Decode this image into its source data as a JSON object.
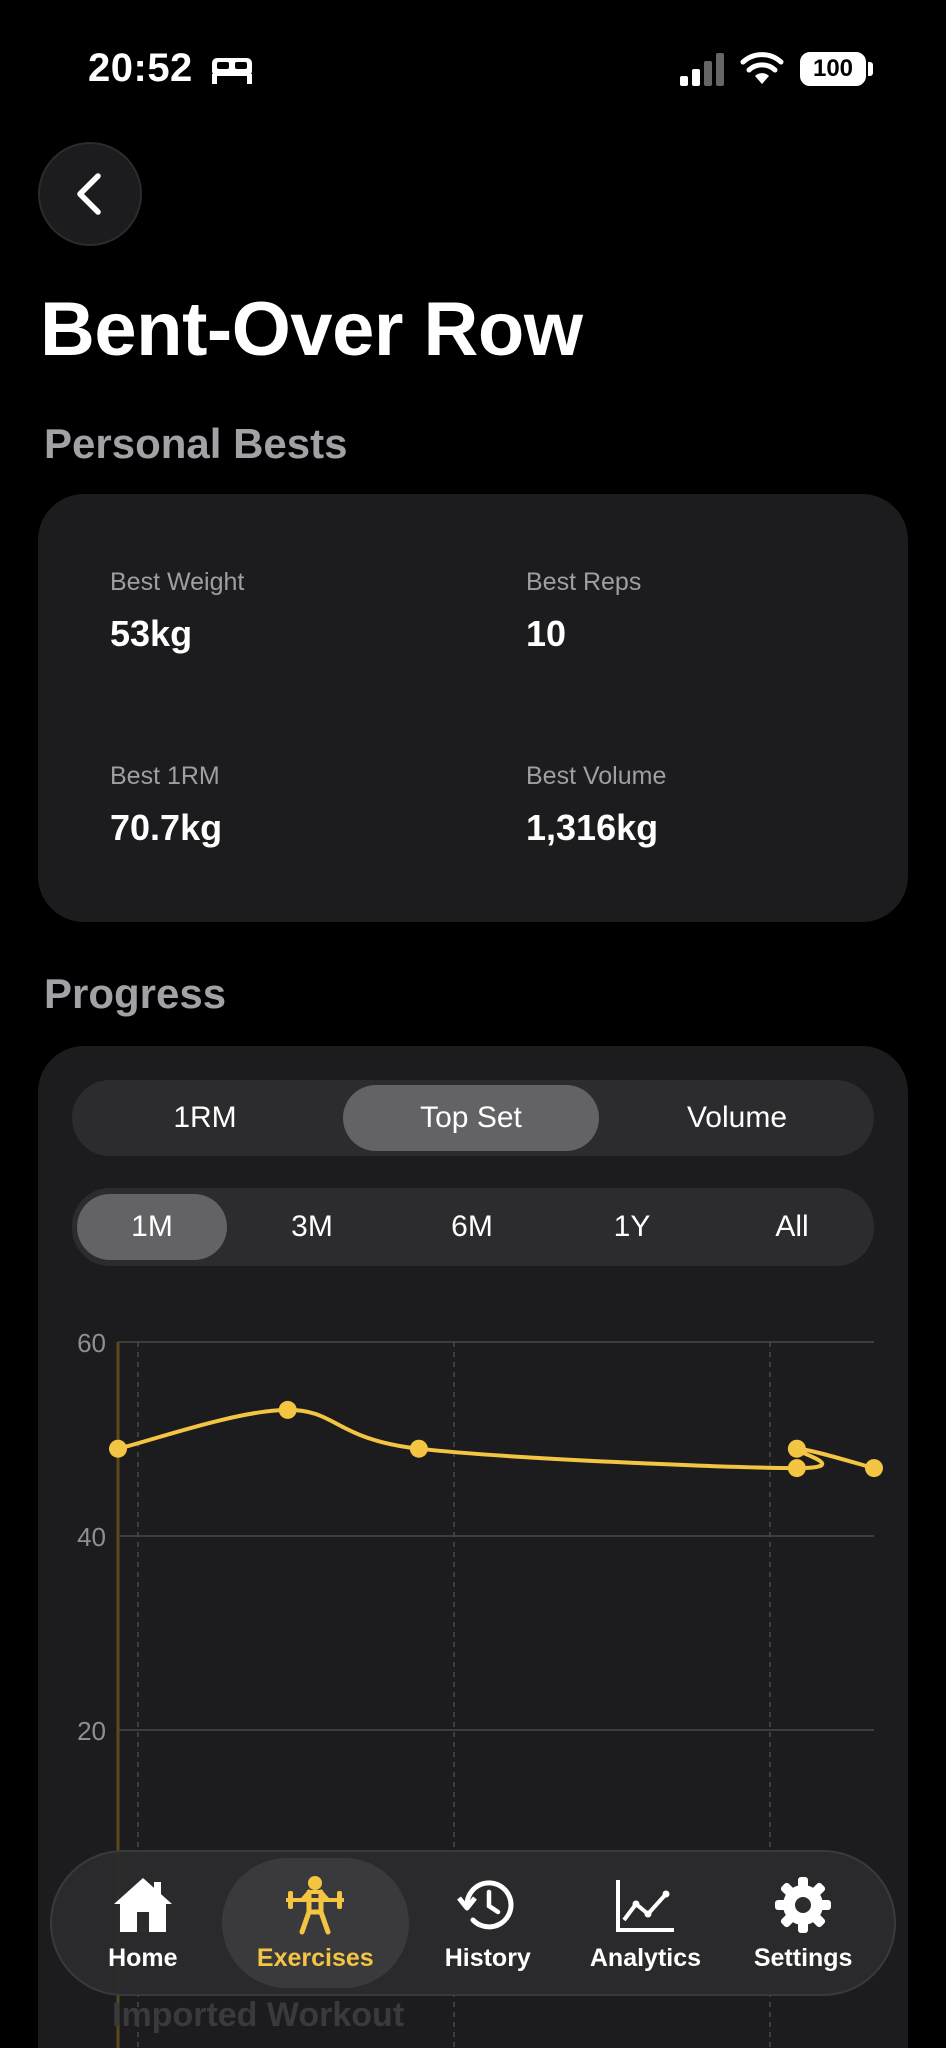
{
  "status_bar": {
    "time": "20:52",
    "battery": "100"
  },
  "header": {
    "title": "Bent-Over Row"
  },
  "personal_bests": {
    "section_title": "Personal Bests",
    "items": [
      {
        "label": "Best Weight",
        "value": "53kg"
      },
      {
        "label": "Best Reps",
        "value": "10"
      },
      {
        "label": "Best 1RM",
        "value": "70.7kg"
      },
      {
        "label": "Best Volume",
        "value": "1,316kg"
      }
    ]
  },
  "progress": {
    "section_title": "Progress",
    "metric_tabs": [
      "1RM",
      "Top Set",
      "Volume"
    ],
    "selected_metric": "Top Set",
    "range_tabs": [
      "1M",
      "3M",
      "6M",
      "1Y",
      "All"
    ],
    "selected_range": "1M"
  },
  "chart_data": {
    "type": "line",
    "x": [
      0,
      2.2,
      3.9,
      8.8,
      8.8,
      9.8
    ],
    "values": [
      49,
      53,
      49,
      47,
      49,
      47
    ],
    "y_ticks": [
      "60",
      "40",
      "20"
    ],
    "ylim": [
      0,
      60
    ],
    "grid": true,
    "line_color": "#f4c542"
  },
  "behind_nav": {
    "text": "Imported Workout"
  },
  "tab_bar": {
    "tabs": [
      {
        "label": "Home",
        "icon": "home-icon"
      },
      {
        "label": "Exercises",
        "icon": "weightlifter-icon"
      },
      {
        "label": "History",
        "icon": "history-icon"
      },
      {
        "label": "Analytics",
        "icon": "analytics-icon"
      },
      {
        "label": "Settings",
        "icon": "gear-icon"
      }
    ],
    "active": "Exercises"
  },
  "colors": {
    "accent": "#f4c542",
    "card": "#1c1c1e",
    "background": "#000000"
  }
}
